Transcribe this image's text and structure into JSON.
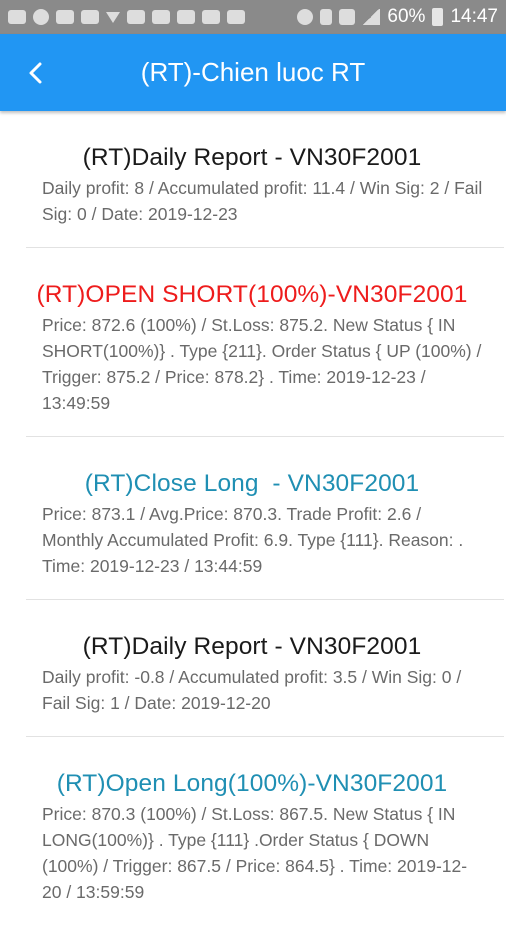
{
  "status_bar": {
    "battery": "60%",
    "time": "14:47"
  },
  "header": {
    "title": "(RT)-Chien luoc RT"
  },
  "items": [
    {
      "title": "(RT)Daily Report - VN30F2001",
      "body": "Daily profit: 8 / Accumulated profit: 11.4 / Win Sig: 2 / Fail Sig: 0 / Date: 2019-12-23",
      "color": "#1a1a1a"
    },
    {
      "title": "(RT)OPEN SHORT(100%)-VN30F2001",
      "body": "Price: 872.6 (100%) / St.Loss: 875.2. New Status { IN SHORT(100%)} . Type {211}. Order Status { UP (100%) / Trigger: 875.2 / Price: 878.2} . Time: 2019-12-23 / 13:49:59",
      "color": "#ee1c1c"
    },
    {
      "title": "(RT)Close Long  - VN30F2001",
      "body": "Price: 873.1 / Avg.Price: 870.3. Trade Profit: 2.6 / Monthly Accumulated Profit: 6.9. Type {111}. Reason: . Time: 2019-12-23 / 13:44:59",
      "color": "#1f8fb3"
    },
    {
      "title": "(RT)Daily Report - VN30F2001",
      "body": "Daily profit: -0.8 / Accumulated profit: 3.5 / Win Sig: 0 / Fail Sig: 1 / Date: 2019-12-20",
      "color": "#1a1a1a"
    },
    {
      "title": "(RT)Open Long(100%)-VN30F2001",
      "body": "Price: 870.3 (100%) / St.Loss: 867.5. New Status { IN LONG(100%)} . Type {111} .Order Status { DOWN (100%) / Trigger: 867.5 / Price: 864.5} . Time: 2019-12-20 / 13:59:59",
      "color": "#1f8fb3"
    }
  ]
}
